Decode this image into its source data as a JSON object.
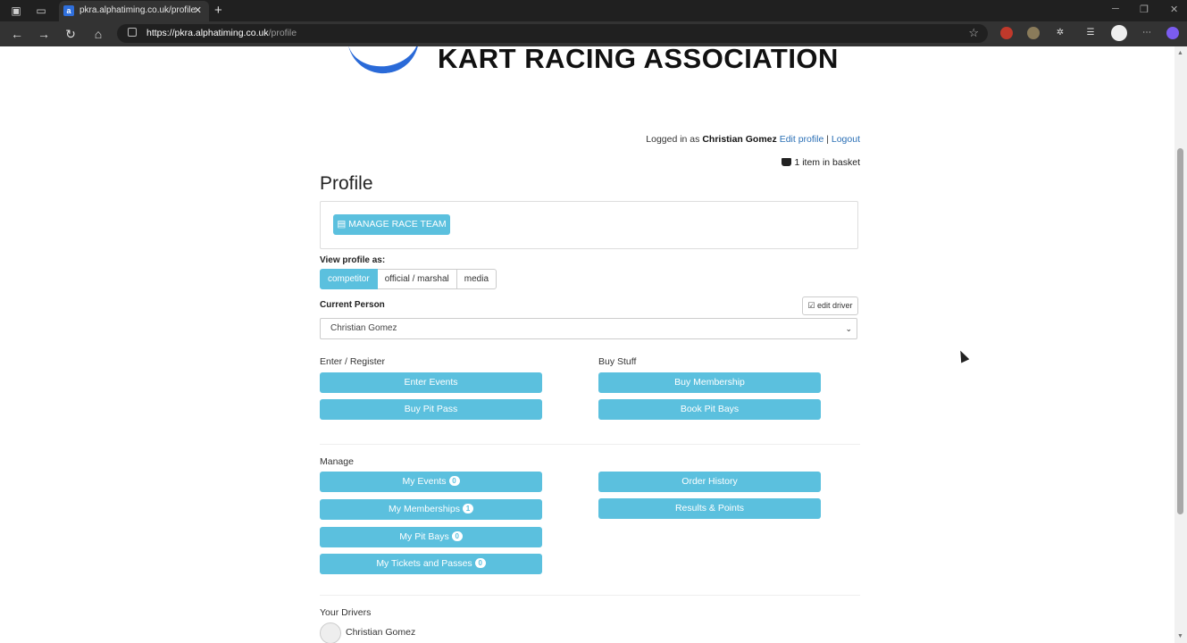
{
  "browser": {
    "tab_title": "pkra.alphatiming.co.uk/profile",
    "url_host": "https://pkra.alphatiming.co.uk",
    "url_path": "/profile"
  },
  "header": {
    "logo_text": "KART RACING ASSOCIATION",
    "logged_in_prefix": "Logged in as",
    "user_name": "Christian Gomez",
    "edit_profile": "Edit profile",
    "separator": "|",
    "logout": "Logout",
    "basket": "1 item in basket"
  },
  "page": {
    "title": "Profile",
    "manage_race_team": "MANAGE RACE TEAM",
    "view_profile_label": "View profile as:",
    "view_options": [
      "competitor",
      "official / marshal",
      "media"
    ],
    "current_person_label": "Current Person",
    "edit_driver": "edit driver",
    "current_person_value": "Christian Gomez"
  },
  "enter_register": {
    "heading": "Enter / Register",
    "buttons": [
      "Enter Events",
      "Buy Pit Pass"
    ]
  },
  "buy_stuff": {
    "heading": "Buy Stuff",
    "buttons": [
      "Buy Membership",
      "Book Pit Bays"
    ]
  },
  "manage": {
    "heading": "Manage",
    "left": [
      {
        "label": "My Events",
        "count": "0"
      },
      {
        "label": "My Memberships",
        "count": "1"
      },
      {
        "label": "My Pit Bays",
        "count": "0"
      },
      {
        "label": "My Tickets and Passes",
        "count": "0"
      }
    ],
    "right": [
      "Order History",
      "Results & Points"
    ]
  },
  "drivers": {
    "heading": "Your Drivers",
    "items": [
      "Christian Gomez"
    ]
  },
  "colors": {
    "accent": "#5bc0de",
    "link": "#2a6fb5"
  }
}
